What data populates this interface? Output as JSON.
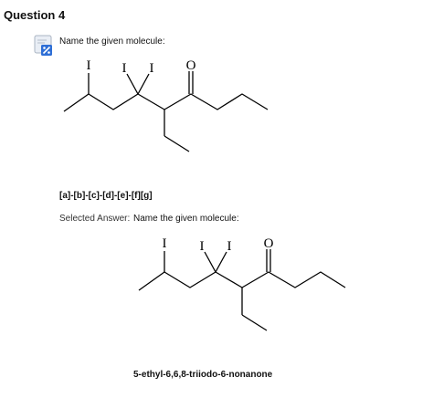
{
  "question": {
    "title": "Question 4",
    "status_icon": "partial-credit-icon",
    "prompt": "Name the given molecule:",
    "answer_template": "[a]-[b]-[c]-[d]-[e]-[f][g]"
  },
  "molecule": {
    "atom_labels": [
      "I",
      "I",
      "I",
      "O"
    ]
  },
  "answer": {
    "selected_label": "Selected Answer:",
    "prompt": "Name the given molecule:",
    "text": "5-ethyl-6,6,8-triiodo-6-nonanone"
  },
  "colors": {
    "icon_blue": "#2f6fd6",
    "text": "#111111"
  }
}
